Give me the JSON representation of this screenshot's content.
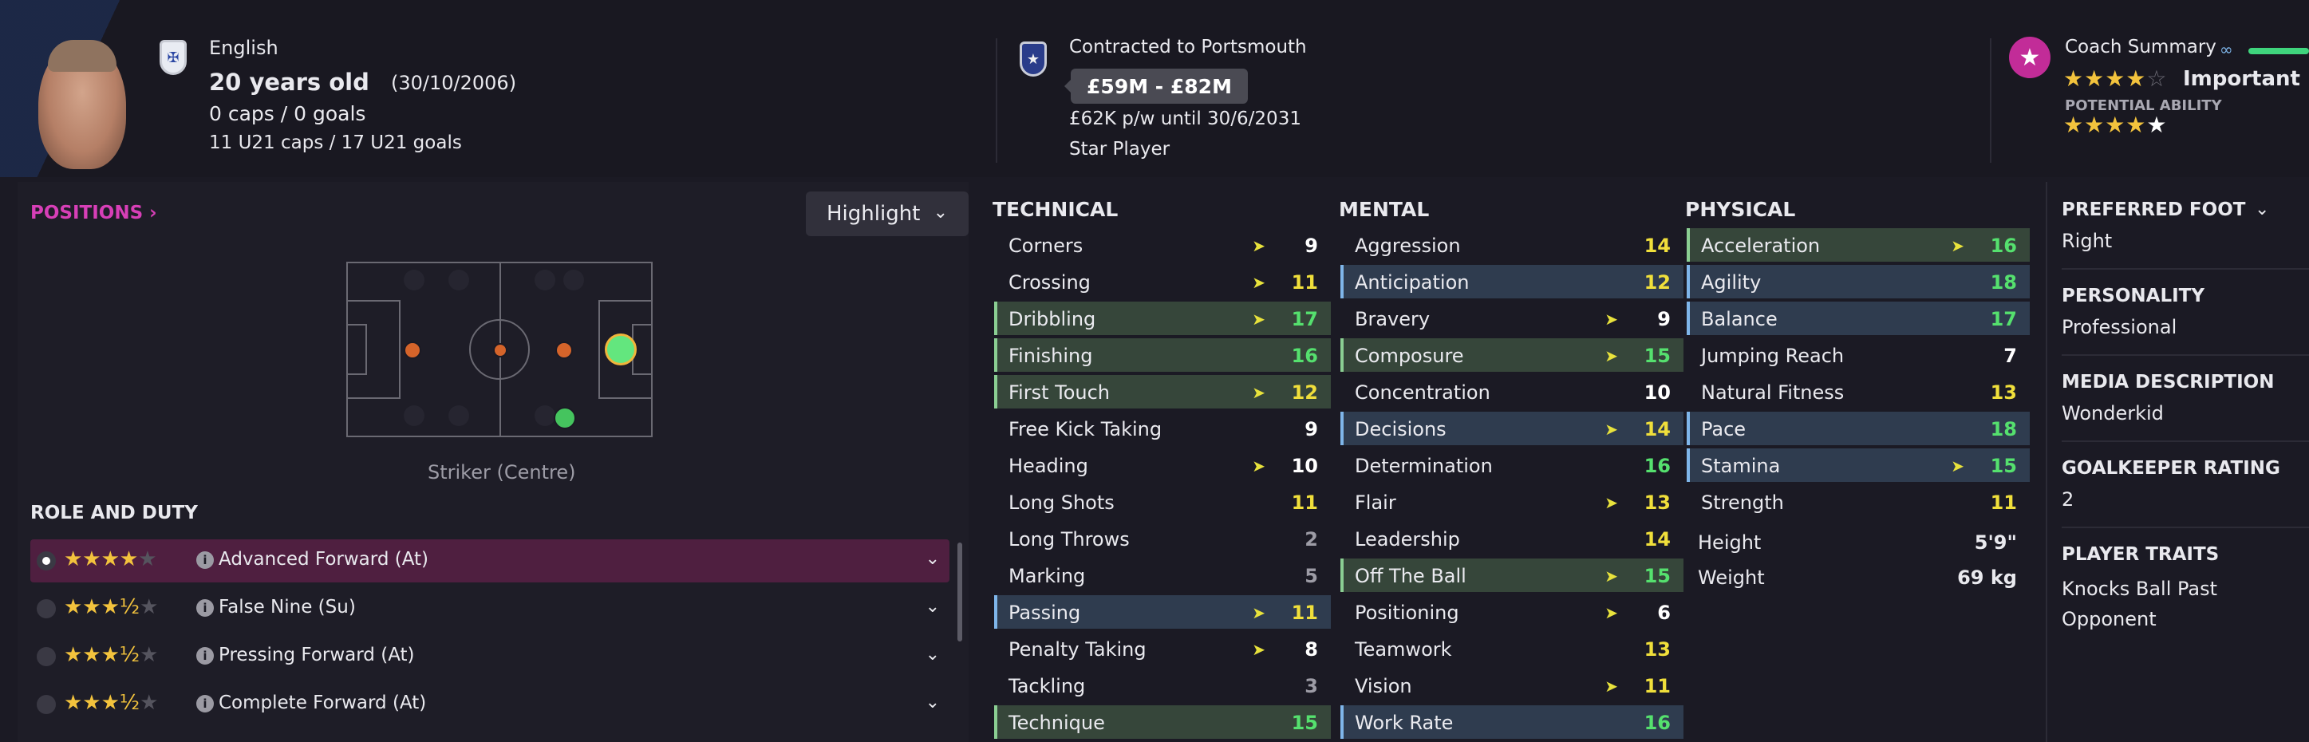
{
  "header": {
    "nationality": "English",
    "age": "20 years old",
    "dob": "(30/10/2006)",
    "caps": "0 caps / 0 goals",
    "u21": "11 U21 caps / 17 U21 goals",
    "contract": "Contracted to Portsmouth",
    "value": "£59M - £82M",
    "wage": "£62K p/w until 30/6/2031",
    "status": "Star Player",
    "coach_summary": "Coach Summary",
    "coach_label": "Important pla",
    "potential_label": "POTENTIAL ABILITY",
    "current_stars": "★★★★",
    "current_half": "☆",
    "potential_stars": "★★★★",
    "potential_white": "★"
  },
  "positions": {
    "title": "POSITIONS",
    "highlight": "Highlight",
    "position_name": "Striker (Centre)"
  },
  "roles": {
    "title": "ROLE AND DUTY",
    "items": [
      {
        "label": "Advanced Forward (At)",
        "stars": "★★★★",
        "dim": "★",
        "selected": true
      },
      {
        "label": "False Nine (Su)",
        "stars": "★★★½",
        "dim": "★",
        "selected": false
      },
      {
        "label": "Pressing Forward (At)",
        "stars": "★★★½",
        "dim": "★",
        "selected": false
      },
      {
        "label": "Complete Forward (At)",
        "stars": "★★★½",
        "dim": "★",
        "selected": false
      }
    ]
  },
  "technical": {
    "title": "TECHNICAL",
    "items": [
      {
        "name": "Corners",
        "value": "9",
        "hl": "",
        "arrow": true
      },
      {
        "name": "Crossing",
        "value": "11",
        "hl": "",
        "arrow": true
      },
      {
        "name": "Dribbling",
        "value": "17",
        "hl": "green",
        "arrow": true
      },
      {
        "name": "Finishing",
        "value": "16",
        "hl": "green",
        "arrow": false
      },
      {
        "name": "First Touch",
        "value": "12",
        "hl": "green",
        "arrow": true
      },
      {
        "name": "Free Kick Taking",
        "value": "9",
        "hl": "",
        "arrow": false
      },
      {
        "name": "Heading",
        "value": "10",
        "hl": "",
        "arrow": true
      },
      {
        "name": "Long Shots",
        "value": "11",
        "hl": "",
        "arrow": false
      },
      {
        "name": "Long Throws",
        "value": "2",
        "hl": "",
        "arrow": false
      },
      {
        "name": "Marking",
        "value": "5",
        "hl": "",
        "arrow": false
      },
      {
        "name": "Passing",
        "value": "11",
        "hl": "blue",
        "arrow": true
      },
      {
        "name": "Penalty Taking",
        "value": "8",
        "hl": "",
        "arrow": true
      },
      {
        "name": "Tackling",
        "value": "3",
        "hl": "",
        "arrow": false
      },
      {
        "name": "Technique",
        "value": "15",
        "hl": "green",
        "arrow": false
      }
    ]
  },
  "mental": {
    "title": "MENTAL",
    "items": [
      {
        "name": "Aggression",
        "value": "14",
        "hl": "",
        "arrow": false
      },
      {
        "name": "Anticipation",
        "value": "12",
        "hl": "blue",
        "arrow": false
      },
      {
        "name": "Bravery",
        "value": "9",
        "hl": "",
        "arrow": true
      },
      {
        "name": "Composure",
        "value": "15",
        "hl": "green",
        "arrow": true
      },
      {
        "name": "Concentration",
        "value": "10",
        "hl": "",
        "arrow": false
      },
      {
        "name": "Decisions",
        "value": "14",
        "hl": "blue",
        "arrow": true
      },
      {
        "name": "Determination",
        "value": "16",
        "hl": "",
        "arrow": false
      },
      {
        "name": "Flair",
        "value": "13",
        "hl": "",
        "arrow": true
      },
      {
        "name": "Leadership",
        "value": "14",
        "hl": "",
        "arrow": false
      },
      {
        "name": "Off The Ball",
        "value": "15",
        "hl": "green",
        "arrow": true
      },
      {
        "name": "Positioning",
        "value": "6",
        "hl": "",
        "arrow": true
      },
      {
        "name": "Teamwork",
        "value": "13",
        "hl": "",
        "arrow": false
      },
      {
        "name": "Vision",
        "value": "11",
        "hl": "",
        "arrow": true
      },
      {
        "name": "Work Rate",
        "value": "16",
        "hl": "blue",
        "arrow": false
      }
    ]
  },
  "physical": {
    "title": "PHYSICAL",
    "items": [
      {
        "name": "Acceleration",
        "value": "16",
        "hl": "green",
        "arrow": true
      },
      {
        "name": "Agility",
        "value": "18",
        "hl": "blue",
        "arrow": false
      },
      {
        "name": "Balance",
        "value": "17",
        "hl": "blue",
        "arrow": false
      },
      {
        "name": "Jumping Reach",
        "value": "7",
        "hl": "",
        "arrow": false
      },
      {
        "name": "Natural Fitness",
        "value": "13",
        "hl": "",
        "arrow": false
      },
      {
        "name": "Pace",
        "value": "18",
        "hl": "blue",
        "arrow": false
      },
      {
        "name": "Stamina",
        "value": "15",
        "hl": "blue",
        "arrow": true
      },
      {
        "name": "Strength",
        "value": "11",
        "hl": "",
        "arrow": false
      }
    ],
    "height_label": "Height",
    "height_value": "5'9\"",
    "weight_label": "Weight",
    "weight_value": "69 kg"
  },
  "info": {
    "preferred_foot_title": "PREFERRED FOOT",
    "preferred_foot": "Right",
    "personality_title": "PERSONALITY",
    "personality": "Professional",
    "media_title": "MEDIA DESCRIPTION",
    "media": "Wonderkid",
    "gk_title": "GOALKEEPER RATING",
    "gk": "2",
    "traits_title": "PLAYER TRAITS",
    "traits_1": "Knocks Ball Past",
    "traits_2": "Opponent"
  },
  "colors": {
    "accent_pink": "#d73fb7",
    "green_high": "#55e06e",
    "yellow_good": "#f0df3b"
  }
}
